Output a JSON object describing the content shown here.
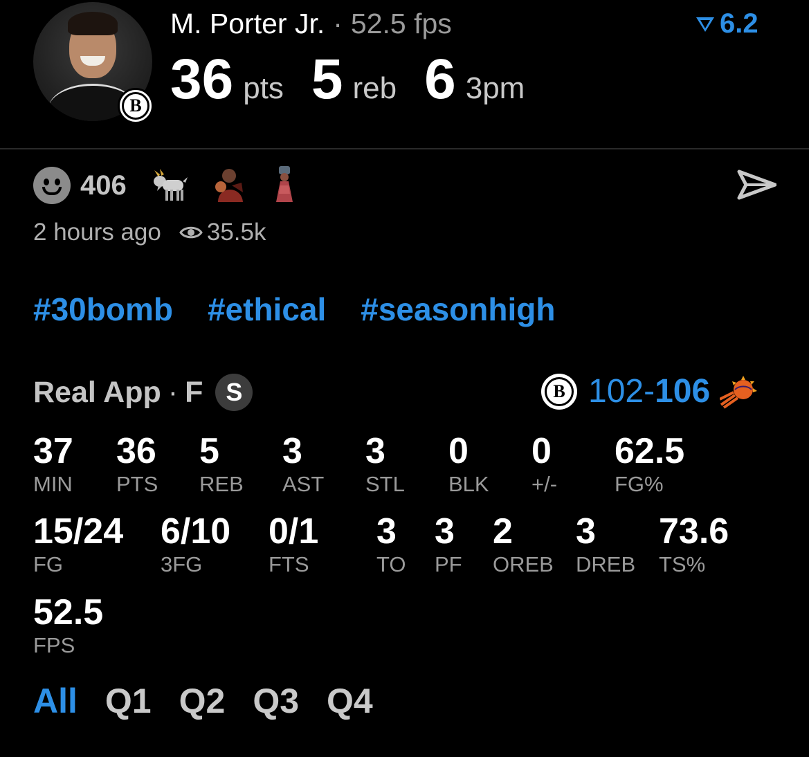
{
  "header": {
    "player_name": "M. Porter Jr.",
    "separator": "·",
    "fps_text": "52.5 fps",
    "rating": "6.2",
    "stats": [
      {
        "value": "36",
        "unit": "pts"
      },
      {
        "value": "5",
        "unit": "reb"
      },
      {
        "value": "6",
        "unit": "3pm"
      }
    ],
    "team_badge_letter": "B"
  },
  "reactions": {
    "count": "406",
    "emojis": [
      "goat-icon",
      "player-sticker-icon",
      "figure-sticker-icon"
    ]
  },
  "meta": {
    "time_ago": "2 hours ago",
    "views": "35.5k"
  },
  "hashtags": [
    "#30bomb",
    "#ethical",
    "#seasonhigh"
  ],
  "game": {
    "source": "Real App",
    "separator": "·",
    "position": "F",
    "badge": "S",
    "home_team_letter": "B",
    "home_score": "102",
    "dash": "-",
    "away_score": "106"
  },
  "stat_rows": [
    [
      {
        "value": "37",
        "label": "MIN"
      },
      {
        "value": "36",
        "label": "PTS"
      },
      {
        "value": "5",
        "label": "REB"
      },
      {
        "value": "3",
        "label": "AST"
      },
      {
        "value": "3",
        "label": "STL"
      },
      {
        "value": "0",
        "label": "BLK"
      },
      {
        "value": "0",
        "label": "+/-"
      },
      {
        "value": "62.5",
        "label": "FG%"
      }
    ],
    [
      {
        "value": "15/24",
        "label": "FG"
      },
      {
        "value": "6/10",
        "label": "3FG"
      },
      {
        "value": "0/1",
        "label": "FTS"
      },
      {
        "value": "3",
        "label": "TO"
      },
      {
        "value": "3",
        "label": "PF"
      },
      {
        "value": "2",
        "label": "OREB"
      },
      {
        "value": "3",
        "label": "DREB"
      },
      {
        "value": "73.6",
        "label": "TS%"
      }
    ],
    [
      {
        "value": "52.5",
        "label": "FPS"
      }
    ]
  ],
  "quarters": [
    "All",
    "Q1",
    "Q2",
    "Q3",
    "Q4"
  ],
  "active_quarter": "All",
  "colors": {
    "accent": "#2d8fe6",
    "background": "#000000",
    "muted_text": "#9a9a9a"
  }
}
